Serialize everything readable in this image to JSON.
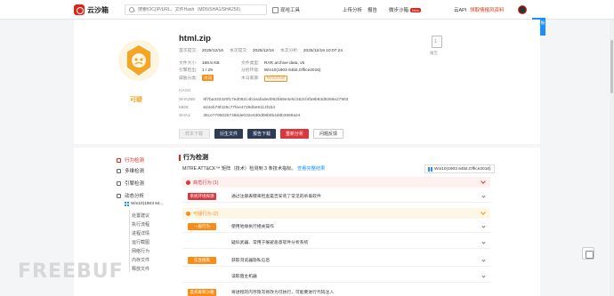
{
  "topbar": {
    "logo_text": "云沙箱",
    "search_placeholder": "搜索IOC(IP/URL、文件Hash（MD5/SHA1/SHA256)",
    "search_button": "现哈工具",
    "nav_upload": "上传分析",
    "nav_report": "报告",
    "nav_sandbox": "微步沙箱",
    "nav_sandbox_badge": "New",
    "nav_ai": "云API",
    "nav_threat": "领取情报风资料",
    "public_box": "公开报告"
  },
  "file": {
    "name": "html.zip",
    "verdict": "可疑",
    "first_submit_label": "首次提交:",
    "first_submit": "2025/12/16",
    "last_submit_label": "本次提交:",
    "last_submit": "2025/12/16",
    "this_analysis_label": "本次分析:",
    "this_analysis": "2025/12/16 10:07:24",
    "size_label": "文件大小:",
    "size": "188.5 KB",
    "type_label": "文件类型:",
    "type": "RAR archive data, v5",
    "engine_label": "引擎检出:",
    "engine": "1 / 28",
    "env_label": "分析环境:",
    "env": "Win10(1903 64bit,Office2016)",
    "threat_label": "威胁分类:",
    "threat": "木马",
    "family_label": "木马家族:",
    "family": "WebShell",
    "doc_count": "1",
    "doc_label": "报告"
  },
  "hash": {
    "title": "HASH",
    "sha256_label": "SHA256:",
    "sha256": "8f7ba333420fc7ed082c4b1eafaded052b69e4e5c352cf4fa9b93d9266e27903",
    "md5_label": "MD5:",
    "md5": "624eb78f425c77fee4729d5e9114f1b3",
    "sha1_label": "SHA1:",
    "sha1": "35ce77950257486de032e630d08b0b4d8b3589a24"
  },
  "actions": {
    "download": "样本下载",
    "generate": "衍生文件",
    "report": "报告下载",
    "reanalyze": "重新分析",
    "feedback": "问题反馈"
  },
  "sidebar": {
    "items": [
      {
        "label": "行为检测"
      },
      {
        "label": "多维检测"
      },
      {
        "label": "引擎检测"
      },
      {
        "label": "动态分析"
      }
    ],
    "env_item": "Win10(1903 64...",
    "subs": [
      "处置建议",
      "执行流程",
      "进程详情",
      "运行截图",
      "网络行为",
      "内存文件",
      "释放文件"
    ]
  },
  "main": {
    "title": "行为检测",
    "mitre_prefix": "MITRE ATT&CK™ 矩阵（技术）检测到",
    "mitre_count": "3",
    "mitre_suffix": "条技术指标。",
    "mitre_link": "查看完整结果",
    "env_tag": "Win10(1903 64bit,Office2016)",
    "high_group": "高危行为 (1)",
    "sus_group": "可疑行为 (2)",
    "rows": [
      {
        "tag": "系统环境探测",
        "text": "通过注册表键来检查是否安装了常见的杀毒软件",
        "color": "red"
      },
      {
        "tag": "一般行为",
        "text": "使用地缘执行相关操作",
        "color": "orange"
      },
      {
        "tag": "",
        "text": "疑似武器、常用于躲避恶意软件分析系统",
        "color": ""
      },
      {
        "tag": "信息搜集",
        "text": "获取浏览器隐私信息",
        "color": "orange"
      },
      {
        "tag": "",
        "text": "读取宿主机器",
        "color": ""
      },
      {
        "tag": "反病毒和沙箱",
        "text": "将进程的内存隐写修改为可执行，可能要进行代码注入",
        "color": "orange"
      }
    ]
  },
  "colors": {
    "brand": "#e2231a",
    "suspicious": "#f5a623",
    "high": "#d9363e",
    "navy": "#2d3b55"
  },
  "watermark": "FREEBUF"
}
